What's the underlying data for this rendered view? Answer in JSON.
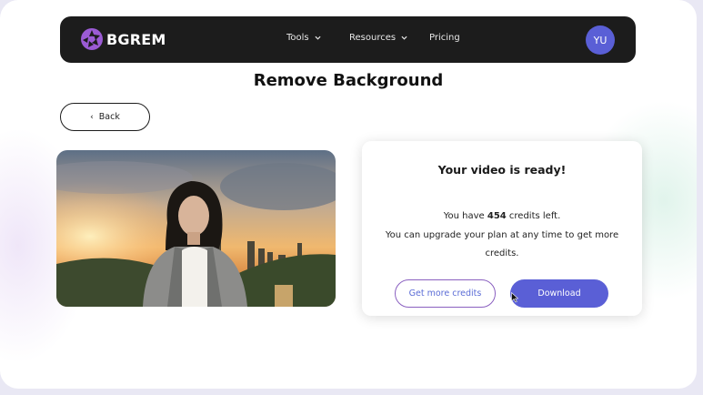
{
  "navbar": {
    "brand": "BGREM",
    "items": [
      {
        "label": "Tools",
        "has_dropdown": true
      },
      {
        "label": "Resources",
        "has_dropdown": true
      },
      {
        "label": "Pricing",
        "has_dropdown": false
      }
    ],
    "avatar_initials": "YU"
  },
  "page": {
    "title": "Remove Background"
  },
  "back_button": {
    "label": "Back"
  },
  "result_card": {
    "title": "Your video is ready!",
    "credits_prefix": "You have ",
    "credits_count": "454",
    "credits_suffix": " credits left.",
    "upgrade_text": "You can upgrade your plan at any time to get more credits.",
    "get_more_label": "Get more credits",
    "download_label": "Download"
  },
  "colors": {
    "navbar_bg": "#1c1c1c",
    "accent": "#5a5fd6",
    "logo_purple": "#9b5bd4"
  }
}
